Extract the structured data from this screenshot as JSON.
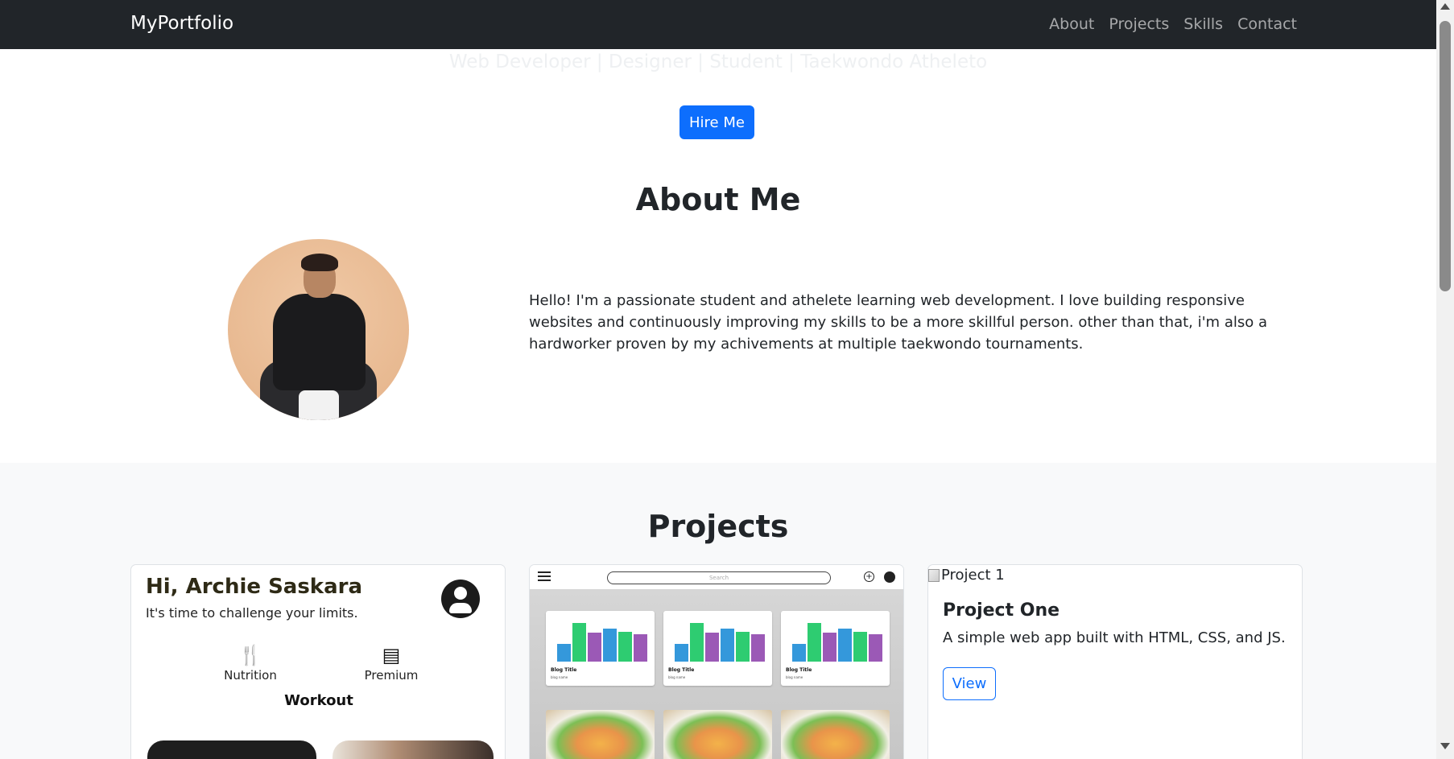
{
  "navbar": {
    "brand": "MyPortfolio",
    "links": [
      "About",
      "Projects",
      "Skills",
      "Contact"
    ]
  },
  "hero": {
    "tagline": "Web Developer | Designer | Student | Taekwondo Atheleto",
    "hire_button": "Hire Me"
  },
  "about": {
    "title": "About Me",
    "text": "Hello! I'm a passionate student and athelete learning web development. I love building responsive websites and continuously improving my skills to be a more skillful person. other than that, i'm also a hardworker proven by my achivements at multiple taekwondo tournaments."
  },
  "projects": {
    "title": "Projects",
    "card1": {
      "greeting": "Hi, Archie Saskara",
      "subtitle": "It's time to challenge your limits.",
      "nutrition_label": "Nutrition",
      "premium_label": "Premium",
      "workout_label": "Workout"
    },
    "card2": {
      "search_placeholder": "Search",
      "blog_title": "Blog Title",
      "blog_sub": "blog name"
    },
    "card3": {
      "image_alt": "Project 1",
      "title": "Project One",
      "description": "A simple web app built with HTML, CSS, and JS.",
      "button": "View"
    }
  },
  "colors": {
    "navbar_bg": "#212529",
    "primary": "#0d6efd",
    "section_alt_bg": "#f8f9fa"
  }
}
